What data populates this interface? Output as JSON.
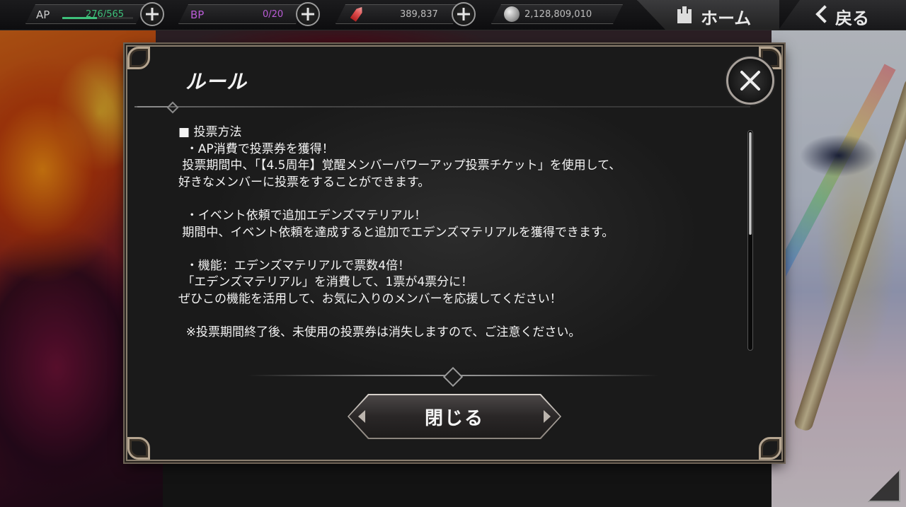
{
  "topbar": {
    "ap": {
      "label": "AP",
      "value": "276/565",
      "fill_fraction": 0.49
    },
    "bp": {
      "label": "BP",
      "value": "0/20"
    },
    "crystals": {
      "value": "389,837"
    },
    "coins": {
      "value": "2,128,809,010"
    },
    "home_label": "ホーム",
    "back_label": "戻る"
  },
  "dialog": {
    "title": "ルール",
    "lines": [
      "■ 投票方法",
      "  ・AP消費で投票券を獲得！",
      " 投票期間中、「【4.5周年】覚醒メンバーパワーアップ投票チケット」を使用して、",
      "好きなメンバーに投票をすることができます。",
      "",
      "  ・イベント依頼で追加エデンズマテリアル！",
      " 期間中、イベント依頼を達成すると追加でエデンズマテリアルを獲得できます。",
      "",
      "  ・機能：エデンズマテリアルで票数4倍！",
      " 「エデンズマテリアル」を消費して、1票が4票分に！",
      "ぜひこの機能を活用して、お気に入りのメンバーを応援してください！",
      "",
      "  ※投票期間終了後、未使用の投票券は消失しますので、ご注意ください。"
    ],
    "close_button_label": "閉じる"
  },
  "colors": {
    "ap_text": "#3ec07a",
    "bp_text": "#b95bd6",
    "dialog_border": "#8a7e6e"
  },
  "icons": [
    "plus-icon",
    "crystal-icon",
    "coin-icon",
    "castle-icon",
    "chevron-left-icon",
    "close-icon",
    "menu-triangle-icon"
  ]
}
